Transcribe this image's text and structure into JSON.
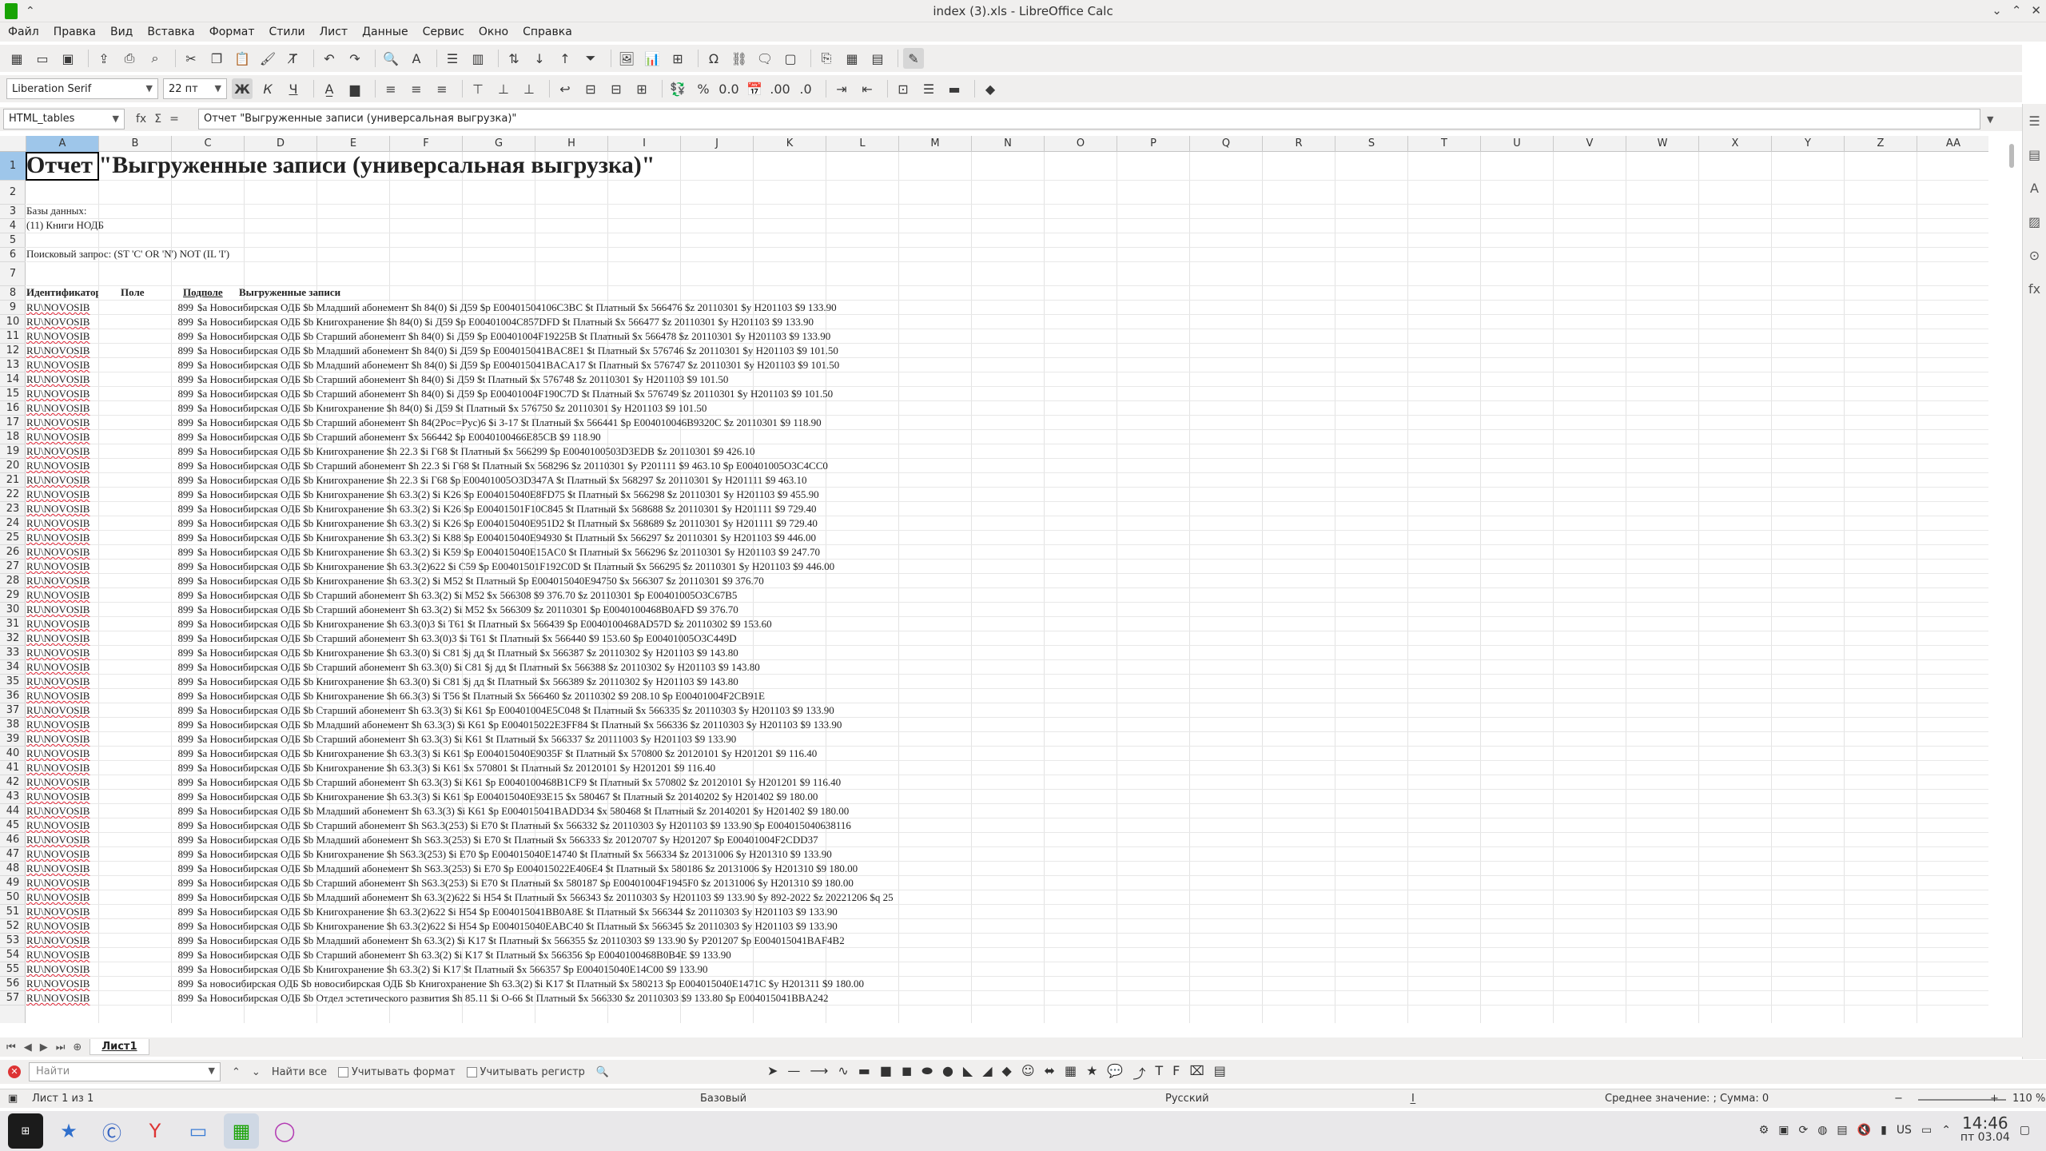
{
  "window": {
    "title": "index (3).xls - LibreOffice Calc"
  },
  "menu": [
    "Файл",
    "Правка",
    "Вид",
    "Вставка",
    "Формат",
    "Стили",
    "Лист",
    "Данные",
    "Сервис",
    "Окно",
    "Справка"
  ],
  "format_toolbar": {
    "font_name": "Liberation Serif",
    "font_size": "22 пт",
    "bold_label": "Ж",
    "italic_label": "К",
    "underline_label": "Ч"
  },
  "formula_bar": {
    "cell_ref": "HTML_tables",
    "content": "Отчет \"Выгруженные записи (универсальная выгрузка)\""
  },
  "columns": [
    "A",
    "B",
    "C",
    "D",
    "E",
    "F",
    "G",
    "H",
    "I",
    "J",
    "K",
    "L",
    "M",
    "N",
    "O",
    "P",
    "Q",
    "R",
    "S",
    "T",
    "U",
    "V",
    "W",
    "X",
    "Y",
    "Z",
    "AA"
  ],
  "sheet": {
    "title": "Отчет \"Выгруженные записи (универсальная выгрузка)\"",
    "db_label": "Базы данных:",
    "db_value": "(11) Книги НОДБ",
    "query": "Поисковый запрос: (ST 'C' OR 'N') NOT (IL 'I')",
    "headers": [
      "Идентификатор",
      "Поле",
      "Подполе",
      "Выгруженные записи"
    ],
    "rows": [
      {
        "n": "9",
        "id": "RU\\NOVOSIB",
        "f": "899",
        "v": "$a Новосибирская ОДБ $b Младший абонемент $h 84(0) $i Д59 $p E00401504106C3BC $t Платный $x 566476 $z 20110301 $y H201103 $9 133.90"
      },
      {
        "n": "10",
        "id": "RU\\NOVOSIB",
        "f": "899",
        "v": "$a Новосибирская ОДБ $b Книгохранение $h 84(0) $i Д59 $p E00401004C857DFD $t Платный $x 566477 $z 20110301 $y H201103 $9 133.90"
      },
      {
        "n": "11",
        "id": "RU\\NOVOSIB",
        "f": "899",
        "v": "$a Новосибирская ОДБ $b Старший абонемент $h 84(0) $i Д59 $p E00401004F19225B $t Платный $x 566478 $z 20110301 $y H201103 $9 133.90"
      },
      {
        "n": "12",
        "id": "RU\\NOVOSIB",
        "f": "899",
        "v": "$a Новосибирская ОДБ $b Младший абонемент $h 84(0) $i Д59 $p E004015041BAC8E1 $t Платный $x 576746 $z 20110301 $y H201103 $9 101.50"
      },
      {
        "n": "13",
        "id": "RU\\NOVOSIB",
        "f": "899",
        "v": "$a Новосибирская ОДБ $b Младший абонемент $h 84(0) $i Д59 $p E004015041BACA17 $t Платный $x 576747 $z 20110301 $y H201103 $9 101.50"
      },
      {
        "n": "14",
        "id": "RU\\NOVOSIB",
        "f": "899",
        "v": "$a Новосибирская ОДБ $b Старший абонемент $h 84(0) $i Д59 $t Платный $x 576748 $z 20110301 $y H201103 $9 101.50"
      },
      {
        "n": "15",
        "id": "RU\\NOVOSIB",
        "f": "899",
        "v": "$a Новосибирская ОДБ $b Старший абонемент $h 84(0) $i Д59 $p E00401004F190C7D $t Платный $x 576749 $z 20110301 $y H201103 $9 101.50"
      },
      {
        "n": "16",
        "id": "RU\\NOVOSIB",
        "f": "899",
        "v": "$a Новосибирская ОДБ $b Книгохранение $h 84(0) $i Д59 $t Платный $x 576750 $z 20110301 $y H201103 $9 101.50"
      },
      {
        "n": "17",
        "id": "RU\\NOVOSIB",
        "f": "899",
        "v": "$a Новосибирская ОДБ $b Старший абонемент $h 84(2Рос=Рус)6 $i З-17 $t Платный $x 566441 $p E004010046B9320C $z 20110301 $9 118.90"
      },
      {
        "n": "18",
        "id": "RU\\NOVOSIB",
        "f": "899",
        "v": "$a Новосибирская ОДБ $b Старший абонемент $x 566442 $p E0040100466E85CB $9 118.90"
      },
      {
        "n": "19",
        "id": "RU\\NOVOSIB",
        "f": "899",
        "v": "$a Новосибирская ОДБ $b Книгохранение $h 22.3 $i Г68 $t Платный $x 566299 $p E0040100503D3EDB $z 20110301 $9 426.10"
      },
      {
        "n": "20",
        "id": "RU\\NOVOSIB",
        "f": "899",
        "v": "$a Новосибирская ОДБ $b Старший абонемент $h 22.3 $i Г68 $t Платный $x 568296 $z 20110301 $y P201111 $9 463.10 $p E00401005O3C4CC0"
      },
      {
        "n": "21",
        "id": "RU\\NOVOSIB",
        "f": "899",
        "v": "$a Новосибирская ОДБ $b Книгохранение $h 22.3 $i Г68 $p E00401005O3D347A $t Платный $x 568297 $z 20110301 $y H201111 $9 463.10"
      },
      {
        "n": "22",
        "id": "RU\\NOVOSIB",
        "f": "899",
        "v": "$a Новосибирская ОДБ $b Книгохранение $h 63.3(2) $i K26 $p E004015040E8FD75 $t Платный $x 566298 $z 20110301 $y H201103 $9 455.90"
      },
      {
        "n": "23",
        "id": "RU\\NOVOSIB",
        "f": "899",
        "v": "$a Новосибирская ОДБ $b Книгохранение $h 63.3(2) $i K26 $p E00401501F10C845 $t Платный $x 568688 $z 20110301 $y H201111 $9 729.40"
      },
      {
        "n": "24",
        "id": "RU\\NOVOSIB",
        "f": "899",
        "v": "$a Новосибирская ОДБ $b Книгохранение $h 63.3(2) $i K26 $p E004015040E951D2 $t Платный $x 568689 $z 20110301 $y H201111 $9 729.40"
      },
      {
        "n": "25",
        "id": "RU\\NOVOSIB",
        "f": "899",
        "v": "$a Новосибирская ОДБ $b Книгохранение $h 63.3(2) $i K88 $p E004015040E94930 $t Платный $x 566297 $z 20110301 $y H201103 $9 446.00"
      },
      {
        "n": "26",
        "id": "RU\\NOVOSIB",
        "f": "899",
        "v": "$a Новосибирская ОДБ $b Книгохранение $h 63.3(2) $i K59 $p E004015040E15AC0 $t Платный $x 566296 $z 20110301 $y H201103 $9 247.70"
      },
      {
        "n": "27",
        "id": "RU\\NOVOSIB",
        "f": "899",
        "v": "$a Новосибирская ОДБ $b Книгохранение $h 63.3(2)622 $i C59 $p E00401501F192C0D $t Платный $x 566295 $z 20110301 $y H201103 $9 446.00"
      },
      {
        "n": "28",
        "id": "RU\\NOVOSIB",
        "f": "899",
        "v": "$a Новосибирская ОДБ $b Книгохранение $h 63.3(2) $i M52 $t Платный $p E004015040E94750 $x 566307 $z 20110301 $9 376.70"
      },
      {
        "n": "29",
        "id": "RU\\NOVOSIB",
        "f": "899",
        "v": "$a Новосибирская ОДБ $b Старший абонемент $h 63.3(2) $i M52 $x 566308 $9 376.70 $z 20110301 $p E00401005O3C67B5"
      },
      {
        "n": "30",
        "id": "RU\\NOVOSIB",
        "f": "899",
        "v": "$a Новосибирская ОДБ $b Старший абонемент $h 63.3(2) $i M52 $x 566309 $z 20110301 $p E0040100468B0AFD $9 376.70"
      },
      {
        "n": "31",
        "id": "RU\\NOVOSIB",
        "f": "899",
        "v": "$a Новосибирская ОДБ $b Книгохранение $h 63.3(0)3 $i T61 $t Платный $x 566439 $p E0040100468AD57D $z 20110302 $9 153.60"
      },
      {
        "n": "32",
        "id": "RU\\NOVOSIB",
        "f": "899",
        "v": "$a Новосибирская ОДБ $b Старший абонемент $h 63.3(0)3 $i T61 $t Платный $x 566440 $9 153.60 $p E00401005O3C449D"
      },
      {
        "n": "33",
        "id": "RU\\NOVOSIB",
        "f": "899",
        "v": "$a Новосибирская ОДБ $b Книгохранение $h 63.3(0) $i C81 $j дд $t Платный $x 566387 $z 20110302 $y H201103 $9 143.80"
      },
      {
        "n": "34",
        "id": "RU\\NOVOSIB",
        "f": "899",
        "v": "$a Новосибирская ОДБ $b Старший абонемент $h 63.3(0) $i C81 $j дд $t Платный $x 566388 $z 20110302 $y H201103 $9 143.80"
      },
      {
        "n": "35",
        "id": "RU\\NOVOSIB",
        "f": "899",
        "v": "$a Новосибирская ОДБ $b Книгохранение $h 63.3(0) $i C81 $j дд $t Платный $x 566389 $z 20110302 $y H201103 $9 143.80"
      },
      {
        "n": "36",
        "id": "RU\\NOVOSIB",
        "f": "899",
        "v": "$a Новосибирская ОДБ $b Книгохранение $h 66.3(3) $i T56 $t Платный $x 566460 $z 20110302 $9 208.10 $p E00401004F2CB91E"
      },
      {
        "n": "37",
        "id": "RU\\NOVOSIB",
        "f": "899",
        "v": "$a Новосибирская ОДБ $b Старший абонемент $h 63.3(3) $i K61 $p E00401004E5C048 $t Платный $x 566335 $z 20110303 $y H201103 $9 133.90"
      },
      {
        "n": "38",
        "id": "RU\\NOVOSIB",
        "f": "899",
        "v": "$a Новосибирская ОДБ $b Младший абонемент $h 63.3(3) $i K61 $p E004015022E3FF84 $t Платный $x 566336 $z 20110303 $y H201103 $9 133.90"
      },
      {
        "n": "39",
        "id": "RU\\NOVOSIB",
        "f": "899",
        "v": "$a Новосибирская ОДБ $b Старший абонемент $h 63.3(3) $i K61 $t Платный $x 566337 $z 20111003 $y H201103 $9 133.90"
      },
      {
        "n": "40",
        "id": "RU\\NOVOSIB",
        "f": "899",
        "v": "$a Новосибирская ОДБ $b Книгохранение $h 63.3(3) $i K61 $p E004015040E9035F $t Платный $x 570800 $z 20120101 $y H201201 $9 116.40"
      },
      {
        "n": "41",
        "id": "RU\\NOVOSIB",
        "f": "899",
        "v": "$a Новосибирская ОДБ $b Книгохранение $h 63.3(3) $i K61 $x 570801 $t Платный $z 20120101 $y H201201 $9 116.40"
      },
      {
        "n": "42",
        "id": "RU\\NOVOSIB",
        "f": "899",
        "v": "$a Новосибирская ОДБ $b Старший абонемент $h 63.3(3) $i K61 $p E0040100468B1CF9 $t Платный $x 570802 $z 20120101 $y H201201 $9 116.40"
      },
      {
        "n": "43",
        "id": "RU\\NOVOSIB",
        "f": "899",
        "v": "$a Новосибирская ОДБ $b Книгохранение $h 63.3(3) $i K61 $p E004015040E93E15 $x 580467 $t Платный $z 20140202 $y H201402 $9 180.00"
      },
      {
        "n": "44",
        "id": "RU\\NOVOSIB",
        "f": "899",
        "v": "$a Новосибирская ОДБ $b Младший абонемент $h 63.3(3) $i K61 $p E004015041BADD34 $x 580468 $t Платный $z 20140201 $y H201402 $9 180.00"
      },
      {
        "n": "45",
        "id": "RU\\NOVOSIB",
        "f": "899",
        "v": "$a Новосибирская ОДБ $b Старший абонемент $h S63.3(253) $i E70 $t Платный $x 566332 $z 20110303 $y H201103 $9 133.90 $p E004015040638116"
      },
      {
        "n": "46",
        "id": "RU\\NOVOSIB",
        "f": "899",
        "v": "$a Новосибирская ОДБ $b Младший абонемент $h S63.3(253) $i E70 $t Платный $x 566333 $z 20120707 $y H201207 $p E00401004F2CDD37"
      },
      {
        "n": "47",
        "id": "RU\\NOVOSIB",
        "f": "899",
        "v": "$a Новосибирская ОДБ $b Книгохранение $h S63.3(253) $i E70 $p E004015040E14740 $t Платный $x 566334 $z 20131006 $y H201310 $9 133.90"
      },
      {
        "n": "48",
        "id": "RU\\NOVOSIB",
        "f": "899",
        "v": "$a Новосибирская ОДБ $b Младший абонемент $h S63.3(253) $i E70 $p E004015022E406E4 $t Платный $x 580186 $z 20131006 $y H201310 $9 180.00"
      },
      {
        "n": "49",
        "id": "RU\\NOVOSIB",
        "f": "899",
        "v": "$a Новосибирская ОДБ $b Старший абонемент $h S63.3(253) $i E70 $t Платный $x 580187 $p E00401004F1945F0 $z 20131006 $y H201310 $9 180.00"
      },
      {
        "n": "50",
        "id": "RU\\NOVOSIB",
        "f": "899",
        "v": "$a Новосибирская ОДБ $b Младший абонемент $h 63.3(2)622 $i H54 $t Платный $x 566343 $z 20110303 $y H201103 $9 133.90 $y 892-2022 $z 20221206 $q 25"
      },
      {
        "n": "51",
        "id": "RU\\NOVOSIB",
        "f": "899",
        "v": "$a Новосибирская ОДБ $b Книгохранение $h 63.3(2)622 $i H54 $p E004015041BB0A8E $t Платный $x 566344 $z 20110303 $y H201103 $9 133.90"
      },
      {
        "n": "52",
        "id": "RU\\NOVOSIB",
        "f": "899",
        "v": "$a Новосибирская ОДБ $b Книгохранение $h 63.3(2)622 $i H54 $p E004015040EABC40 $t Платный $x 566345 $z 20110303 $y H201103 $9 133.90"
      },
      {
        "n": "53",
        "id": "RU\\NOVOSIB",
        "f": "899",
        "v": "$a Новосибирская ОДБ $b Младший абонемент $h 63.3(2) $i K17 $t Платный $x 566355 $z 20110303 $9 133.90 $y P201207 $p E004015041BAF4B2"
      },
      {
        "n": "54",
        "id": "RU\\NOVOSIB",
        "f": "899",
        "v": "$a Новосибирская ОДБ $b Старший абонемент $h 63.3(2) $i K17 $t Платный $x 566356 $p E0040100468B0B4E $9 133.90"
      },
      {
        "n": "55",
        "id": "RU\\NOVOSIB",
        "f": "899",
        "v": "$a Новосибирская ОДБ $b Книгохранение $h 63.3(2) $i K17 $t Платный $x 566357 $p E004015040E14C00 $9 133.90"
      },
      {
        "n": "56",
        "id": "RU\\NOVOSIB",
        "f": "899",
        "v": "$a новосибирская ОДБ $b новосибирская ОДБ $b Книгохранение $h 63.3(2) $i K17 $t Платный $x 580213 $p E004015040E1471C $y H201311 $9 180.00"
      },
      {
        "n": "57",
        "id": "RU\\NOVOSIB",
        "f": "899",
        "v": "$a Новосибирская ОДБ $b Отдел эстетического развития $h 85.11 $i O-66 $t Платный $x 566330 $z 20110303 $9 133.80 $p E004015041BBA242"
      }
    ]
  },
  "sheet_tabs": {
    "active": "Лист1"
  },
  "find_bar": {
    "placeholder": "Найти",
    "find_all": "Найти все",
    "match_format": "Учитывать формат",
    "match_case": "Учитывать регистр"
  },
  "status_bar": {
    "sheet_info": "Лист 1 из 1",
    "style": "Базовый",
    "language": "Русский",
    "summary": "Среднее значение: ; Сумма: 0",
    "zoom": "110 %"
  },
  "tray": {
    "lang": "US",
    "time": "14:46",
    "date": "пт 03.04"
  }
}
